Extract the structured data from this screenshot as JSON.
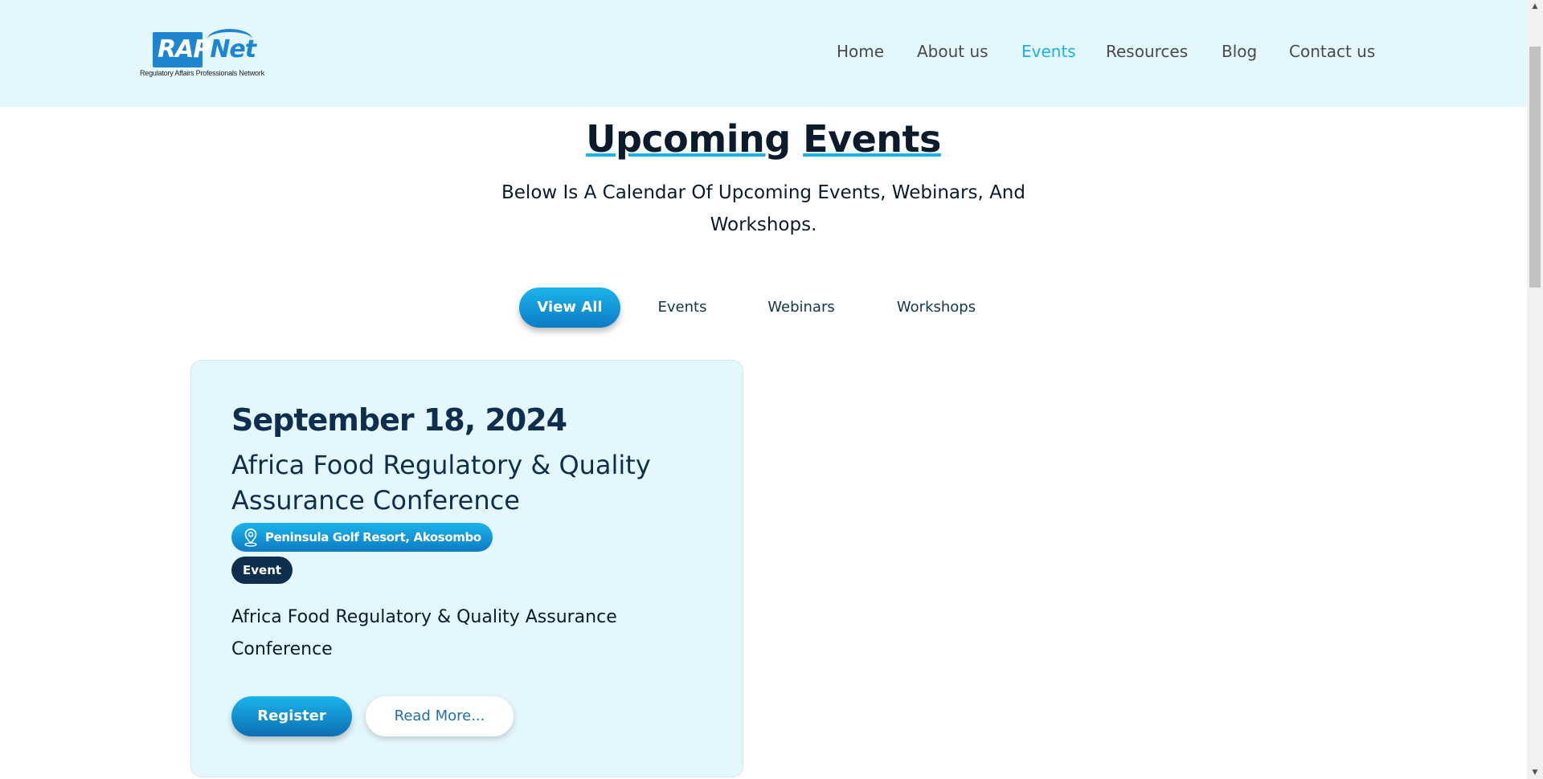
{
  "header": {
    "logo": {
      "text_rap": "RAP",
      "text_net": "Net",
      "tagline": "Regulatory Affairs Professionals Network"
    },
    "nav": [
      {
        "label": "Home",
        "active": false
      },
      {
        "label": "About us",
        "active": false
      },
      {
        "label": "Events",
        "active": true
      },
      {
        "label": "Resources",
        "active": false
      },
      {
        "label": "Blog",
        "active": false
      },
      {
        "label": "Contact us",
        "active": false
      }
    ]
  },
  "main": {
    "title_word1": "Upcoming",
    "title_word2": "Events",
    "subtitle": "Below Is A Calendar Of Upcoming Events, Webinars, And Workshops.",
    "filters": [
      {
        "label": "View All",
        "active": true
      },
      {
        "label": "Events",
        "active": false
      },
      {
        "label": "Webinars",
        "active": false
      },
      {
        "label": "Workshops",
        "active": false
      }
    ],
    "events": [
      {
        "date": "September 18, 2024",
        "title": "Africa Food Regulatory & Quality Assurance Conference",
        "location": "Peninsula Golf Resort, Akosombo",
        "type": "Event",
        "description": "Africa Food Regulatory & Quality Assurance Conference",
        "register_label": "Register",
        "read_more_label": "Read More..."
      }
    ]
  },
  "colors": {
    "accent": "#1ab0e8",
    "header_bg": "#e4f7fc",
    "navy": "#0e2e4e"
  }
}
